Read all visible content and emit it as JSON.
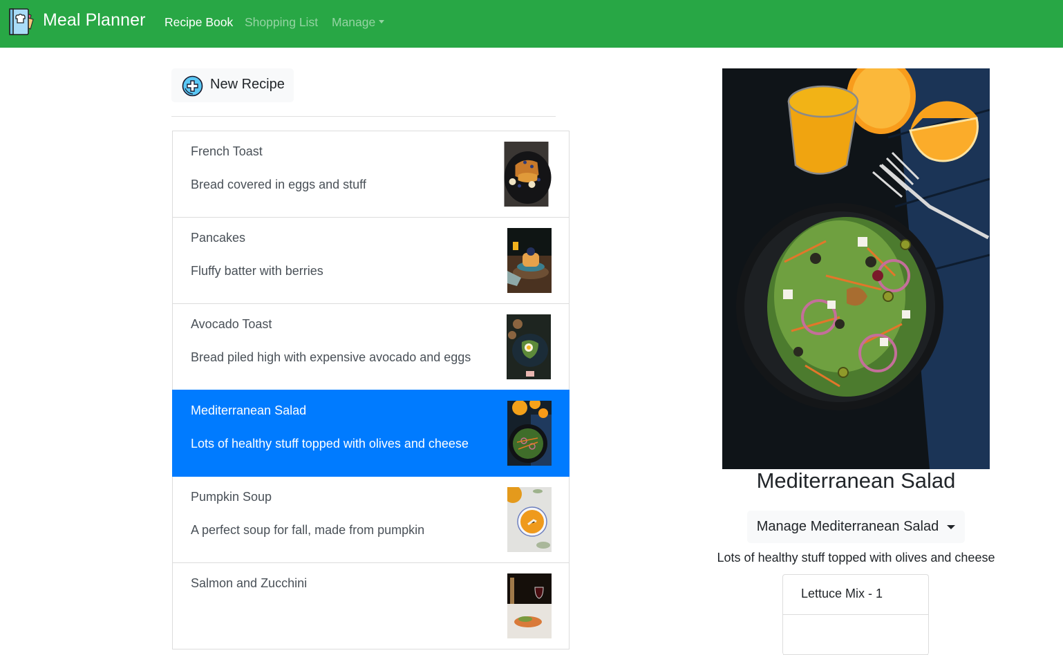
{
  "navbar": {
    "brand": "Meal Planner",
    "brand_icon": "recipe-book-icon",
    "color": "#28a745",
    "links": [
      {
        "label": "Recipe Book",
        "active": true
      },
      {
        "label": "Shopping List",
        "active": false
      },
      {
        "label": "Manage",
        "active": false,
        "dropdown": true
      }
    ]
  },
  "toolbar": {
    "new_recipe_label": "New Recipe",
    "new_recipe_icon": "plus-circle-icon"
  },
  "recipes": [
    {
      "name": "French Toast",
      "description": "Bread covered in eggs and stuff",
      "active": false
    },
    {
      "name": "Pancakes",
      "description": "Fluffy batter with berries",
      "active": false
    },
    {
      "name": "Avocado Toast",
      "description": "Bread piled high with expensive avocado and eggs",
      "active": false
    },
    {
      "name": "Mediterranean Salad",
      "description": "Lots of healthy stuff topped with olives and cheese",
      "active": true
    },
    {
      "name": "Pumpkin Soup",
      "description": "A perfect soup for fall, made from pumpkin",
      "active": false
    },
    {
      "name": "Salmon and Zucchini",
      "description": "",
      "active": false
    }
  ],
  "selected_color": "#007bff",
  "detail": {
    "title": "Mediterranean Salad",
    "manage_label": "Manage Mediterranean Salad",
    "description": "Lots of healthy stuff topped with olives and cheese",
    "ingredients": [
      "Lettuce Mix - 1"
    ]
  }
}
